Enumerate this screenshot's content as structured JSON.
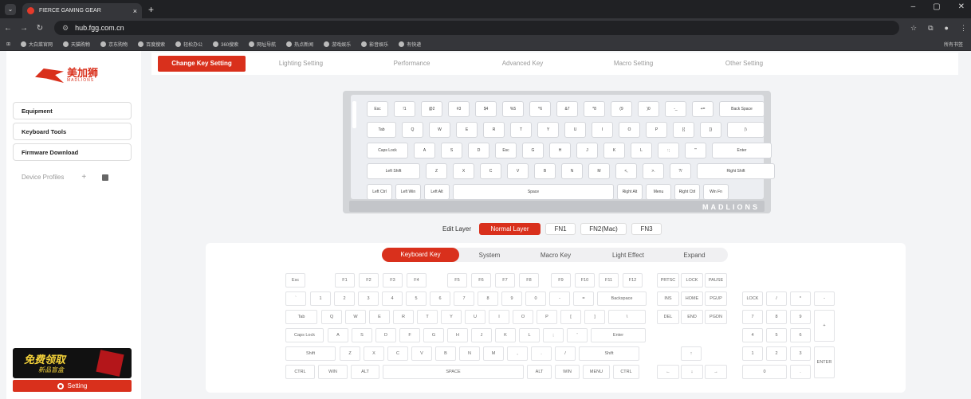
{
  "browser": {
    "tab_title": "FIERCE GAMING GEAR",
    "url": "hub.fgg.com.cn",
    "bookmarks": [
      "大白菜官网",
      "天猫购物",
      "京东购物",
      "百度搜索",
      "轻松办公",
      "360搜索",
      "网址导航",
      "热点新闻",
      "游戏娱乐",
      "影音娱乐",
      "有快递"
    ],
    "all_bookmarks": "所有书签"
  },
  "sidebar": {
    "brand_cn": "美加狮",
    "brand_en": "MADLIONS",
    "items": [
      "Equipment",
      "Keyboard Tools",
      "Firmware Download"
    ],
    "profiles_label": "Device Profiles",
    "promo_line1": "免费领取",
    "promo_line2": "新品盲盒",
    "setting_label": "Setting"
  },
  "topnav": [
    "Change Key Setting",
    "Lighting Setting",
    "Performance",
    "Advanced Key",
    "Macro Setting",
    "Other Setting"
  ],
  "keyboard": {
    "brand": "MADLIONS",
    "rows": [
      [
        "Esc",
        "!1",
        "@2",
        "#3",
        "$4",
        "%5",
        "^6",
        "&7",
        "*8",
        "(9",
        ")0",
        "-_",
        "+=",
        "Back Space"
      ],
      [
        "Tab",
        "Q",
        "W",
        "E",
        "R",
        "T",
        "Y",
        "U",
        "I",
        "O",
        "P",
        "[{",
        "]}",
        "|\\"
      ],
      [
        "Caps Lock",
        "A",
        "S",
        "D",
        "Esc",
        "G",
        "H",
        "J",
        "K",
        "L",
        ":;",
        "\"'",
        "Enter"
      ],
      [
        "Left Shift",
        "Z",
        "X",
        "C",
        "V",
        "B",
        "N",
        "M",
        "<,",
        ">.",
        "?/",
        "Right Shift"
      ],
      [
        "Left Ctrl",
        "Left Win",
        "Left Alt",
        "Space",
        "Right Alt",
        "Menu",
        "Right Ctrl",
        "Win Fn"
      ]
    ]
  },
  "layers": {
    "label": "Edit Layer",
    "items": [
      "Normal Layer",
      "FN1",
      "FN2(Mac)",
      "FN3"
    ]
  },
  "panel_tabs": [
    "Keyboard Key",
    "System",
    "Macro Key",
    "Light Effect",
    "Expand"
  ],
  "fullkb": {
    "row0": [
      "Esc",
      "F1",
      "F2",
      "F3",
      "F4",
      "F5",
      "F6",
      "F7",
      "F8",
      "F9",
      "F10",
      "F11",
      "F12",
      "PRTSC",
      "LOCK",
      "PAUSE"
    ],
    "row1": [
      "`",
      "1",
      "2",
      "3",
      "4",
      "5",
      "6",
      "7",
      "8",
      "9",
      "0",
      "-",
      "=",
      "Backspace",
      "INS",
      "HOME",
      "PGUP",
      "LOCK",
      "/",
      "*",
      "-"
    ],
    "row2": [
      "Tab",
      "Q",
      "W",
      "E",
      "R",
      "T",
      "Y",
      "U",
      "I",
      "O",
      "P",
      "[",
      "]",
      "\\",
      "DEL",
      "END",
      "PGDN",
      "7",
      "8",
      "9",
      "+"
    ],
    "row3": [
      "Caps Lock",
      "A",
      "S",
      "D",
      "F",
      "G",
      "H",
      "J",
      "K",
      "L",
      ";",
      "'",
      "Enter",
      "4",
      "5",
      "6"
    ],
    "row4": [
      "Shift",
      "Z",
      "X",
      "C",
      "V",
      "B",
      "N",
      "M",
      ",",
      ".",
      "/",
      "Shift",
      "↑",
      "1",
      "2",
      "3",
      "ENTER"
    ],
    "row5": [
      "CTRL",
      "WIN",
      "ALT",
      "SPACE",
      "ALT",
      "WIN",
      "MENU",
      "CTRL",
      "←",
      "↓",
      "→",
      "0",
      "."
    ]
  }
}
